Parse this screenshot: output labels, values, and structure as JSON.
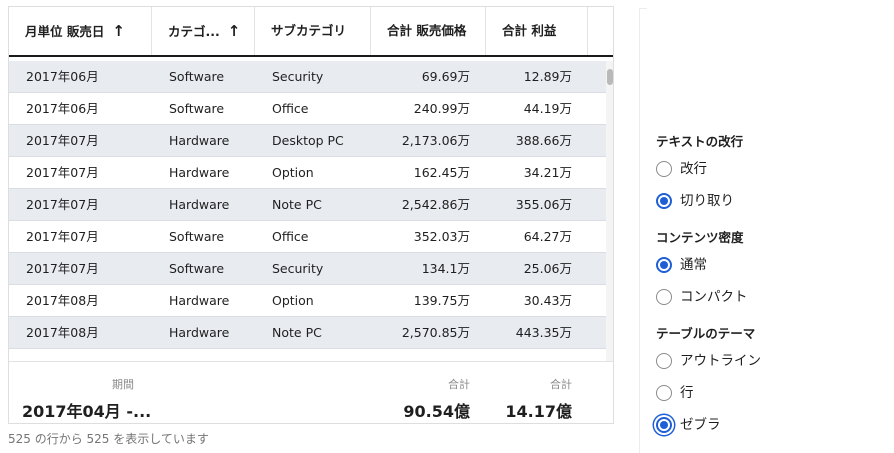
{
  "table": {
    "columns": [
      {
        "label": "月単位 販売日",
        "sort_icon": "arrow-up-icon"
      },
      {
        "label": "カテゴ...",
        "sort_icon": "arrow-up-icon"
      },
      {
        "label": "サブカテゴリ"
      },
      {
        "label": "合計 販売価格"
      },
      {
        "label": "合計 利益"
      }
    ],
    "sort_arrow": "↑",
    "rows": [
      [
        "2017年06月",
        "Software",
        "Security",
        "69.69万",
        "12.89万"
      ],
      [
        "2017年06月",
        "Software",
        "Office",
        "240.99万",
        "44.19万"
      ],
      [
        "2017年07月",
        "Hardware",
        "Desktop PC",
        "2,173.06万",
        "388.66万"
      ],
      [
        "2017年07月",
        "Hardware",
        "Option",
        "162.45万",
        "34.21万"
      ],
      [
        "2017年07月",
        "Hardware",
        "Note PC",
        "2,542.86万",
        "355.06万"
      ],
      [
        "2017年07月",
        "Software",
        "Office",
        "352.03万",
        "64.27万"
      ],
      [
        "2017年07月",
        "Software",
        "Security",
        "134.1万",
        "25.06万"
      ],
      [
        "2017年08月",
        "Hardware",
        "Option",
        "139.75万",
        "30.43万"
      ],
      [
        "2017年08月",
        "Hardware",
        "Note PC",
        "2,570.85万",
        "443.35万"
      ]
    ],
    "footer": {
      "period_label": "期間",
      "period_value": "2017年04月 -...",
      "price_label": "合計",
      "price_value": "90.54億",
      "profit_label": "合計",
      "profit_value": "14.17億"
    },
    "caption": "525 の行から 525 を表示しています"
  },
  "settings": {
    "text_wrap": {
      "title": "テキストの改行",
      "options": [
        {
          "label": "改行",
          "checked": false
        },
        {
          "label": "切り取り",
          "checked": true
        }
      ]
    },
    "density": {
      "title": "コンテンツ密度",
      "options": [
        {
          "label": "通常",
          "checked": true
        },
        {
          "label": "コンパクト",
          "checked": false
        }
      ]
    },
    "theme": {
      "title": "テーブルのテーマ",
      "options": [
        {
          "label": "アウトライン",
          "checked": false
        },
        {
          "label": "行",
          "checked": false
        },
        {
          "label": "ゼブラ",
          "checked": true
        }
      ]
    }
  },
  "colors": {
    "accent": "#1f5fd6",
    "zebra_row": "#e8ebf0"
  }
}
